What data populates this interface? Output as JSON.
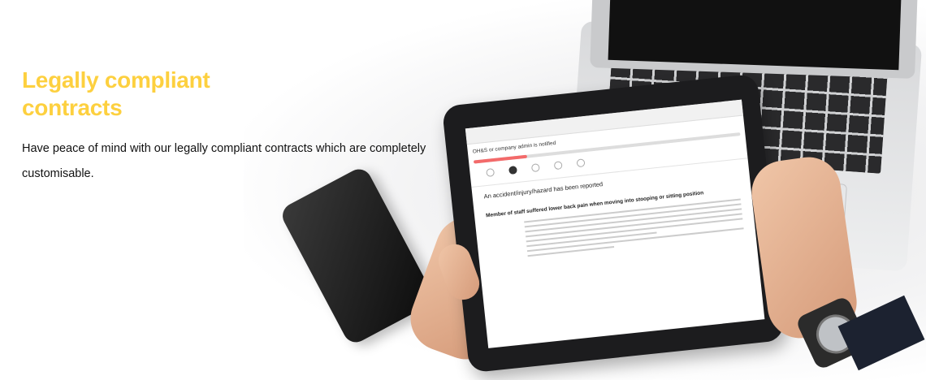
{
  "hero": {
    "title_line1": "Legally compliant",
    "title_line2": "contracts",
    "description": "Have peace of mind with our legally compliant contracts which are completely customisable."
  },
  "tablet_screen": {
    "card_title": "OH&S or company admin is notified",
    "heading": "An accident/injury/hazard has been reported",
    "subheading": "Member of staff suffered lower back pain when moving into stooping or sitting position",
    "progress_fraction": 0.2
  },
  "colors": {
    "title": "#fdd03f",
    "progress": "#f36a6a"
  }
}
